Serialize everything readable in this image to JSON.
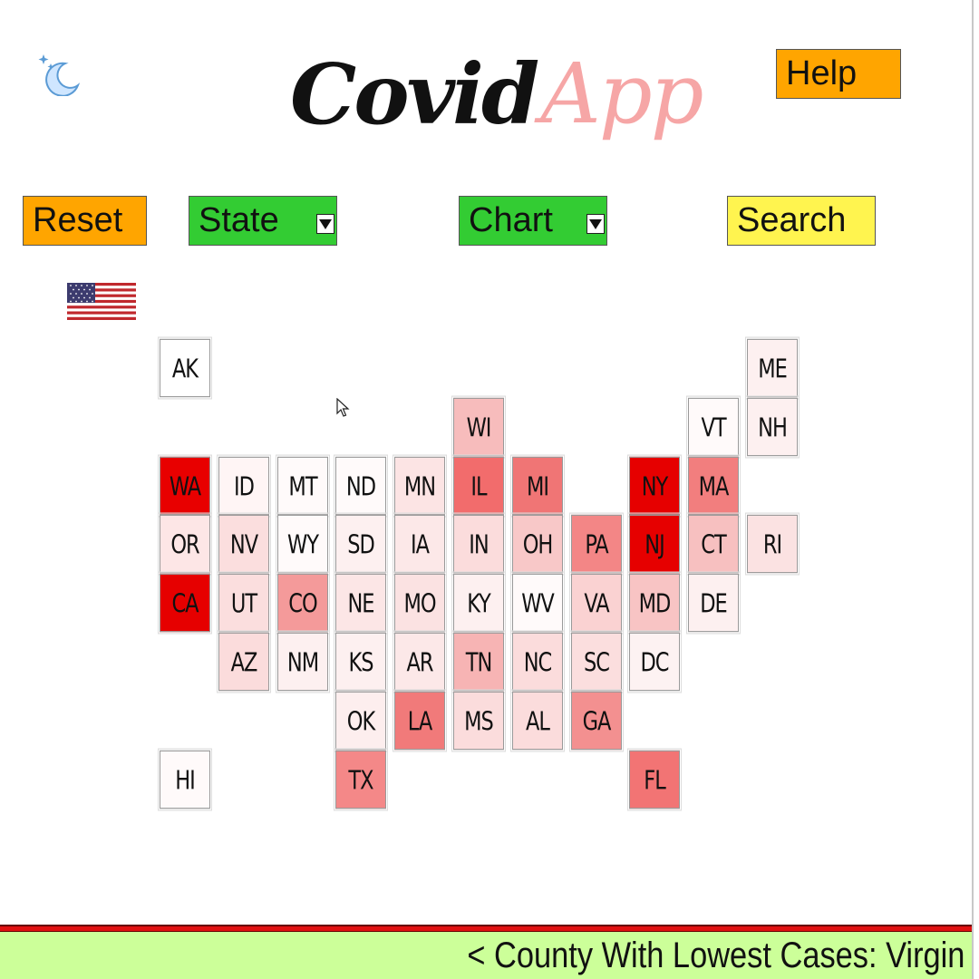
{
  "header": {
    "logo_word1": "Covid",
    "logo_word2": "App",
    "help_label": "Help",
    "theme_icon": "moon-stars-icon"
  },
  "toolbar": {
    "reset_label": "Reset",
    "state_label": "State",
    "chart_label": "Chart",
    "search_label": "Search"
  },
  "country_flag": "us-flag-icon",
  "colors": {
    "orange": "#ffa500",
    "green": "#33cc33",
    "yellow": "#fff44f",
    "footer_bg": "#ccff99",
    "footer_rule": "#e01010",
    "logo_pink": "#f6a6a6"
  },
  "map": {
    "layout": "tile-grid",
    "states": [
      {
        "code": "AK",
        "row": 0,
        "col": 0,
        "fill": "#ffffff"
      },
      {
        "code": "ME",
        "row": 0,
        "col": 10,
        "fill": "#fdf0f0"
      },
      {
        "code": "WI",
        "row": 1,
        "col": 5,
        "fill": "#f7bcbc"
      },
      {
        "code": "VT",
        "row": 1,
        "col": 9,
        "fill": "#fffafa"
      },
      {
        "code": "NH",
        "row": 1,
        "col": 10,
        "fill": "#fdf0f0"
      },
      {
        "code": "WA",
        "row": 2,
        "col": 0,
        "fill": "#e80000"
      },
      {
        "code": "ID",
        "row": 2,
        "col": 1,
        "fill": "#fff5f5"
      },
      {
        "code": "MT",
        "row": 2,
        "col": 2,
        "fill": "#fffafa"
      },
      {
        "code": "ND",
        "row": 2,
        "col": 3,
        "fill": "#fffafa"
      },
      {
        "code": "MN",
        "row": 2,
        "col": 4,
        "fill": "#fce4e4"
      },
      {
        "code": "IL",
        "row": 2,
        "col": 5,
        "fill": "#f26c6c"
      },
      {
        "code": "MI",
        "row": 2,
        "col": 6,
        "fill": "#f07575"
      },
      {
        "code": "NY",
        "row": 2,
        "col": 8,
        "fill": "#e60000"
      },
      {
        "code": "MA",
        "row": 2,
        "col": 9,
        "fill": "#f27e7e"
      },
      {
        "code": "OR",
        "row": 3,
        "col": 0,
        "fill": "#fde6e6"
      },
      {
        "code": "NV",
        "row": 3,
        "col": 1,
        "fill": "#fbdede"
      },
      {
        "code": "WY",
        "row": 3,
        "col": 2,
        "fill": "#fffafa"
      },
      {
        "code": "SD",
        "row": 3,
        "col": 3,
        "fill": "#fdf0f0"
      },
      {
        "code": "IA",
        "row": 3,
        "col": 4,
        "fill": "#fce8e8"
      },
      {
        "code": "IN",
        "row": 3,
        "col": 5,
        "fill": "#fbdcdc"
      },
      {
        "code": "OH",
        "row": 3,
        "col": 6,
        "fill": "#f8c8c8"
      },
      {
        "code": "PA",
        "row": 3,
        "col": 7,
        "fill": "#f38686"
      },
      {
        "code": "NJ",
        "row": 3,
        "col": 8,
        "fill": "#e60000"
      },
      {
        "code": "CT",
        "row": 3,
        "col": 9,
        "fill": "#f7c0c0"
      },
      {
        "code": "RI",
        "row": 3,
        "col": 10,
        "fill": "#fbe2e2"
      },
      {
        "code": "CA",
        "row": 4,
        "col": 0,
        "fill": "#e60000"
      },
      {
        "code": "UT",
        "row": 4,
        "col": 1,
        "fill": "#fbdede"
      },
      {
        "code": "CO",
        "row": 4,
        "col": 2,
        "fill": "#f49a9a"
      },
      {
        "code": "NE",
        "row": 4,
        "col": 3,
        "fill": "#fce6e6"
      },
      {
        "code": "MO",
        "row": 4,
        "col": 4,
        "fill": "#fbe2e2"
      },
      {
        "code": "KY",
        "row": 4,
        "col": 5,
        "fill": "#fdf0f0"
      },
      {
        "code": "WV",
        "row": 4,
        "col": 6,
        "fill": "#fffafa"
      },
      {
        "code": "VA",
        "row": 4,
        "col": 7,
        "fill": "#fad2d2"
      },
      {
        "code": "MD",
        "row": 4,
        "col": 8,
        "fill": "#f8c4c4"
      },
      {
        "code": "DE",
        "row": 4,
        "col": 9,
        "fill": "#fdf0f0"
      },
      {
        "code": "AZ",
        "row": 5,
        "col": 1,
        "fill": "#fbdcdc"
      },
      {
        "code": "NM",
        "row": 5,
        "col": 2,
        "fill": "#fdf0f0"
      },
      {
        "code": "KS",
        "row": 5,
        "col": 3,
        "fill": "#fdf0f0"
      },
      {
        "code": "AR",
        "row": 5,
        "col": 4,
        "fill": "#fce8e8"
      },
      {
        "code": "TN",
        "row": 5,
        "col": 5,
        "fill": "#f7b4b4"
      },
      {
        "code": "NC",
        "row": 5,
        "col": 6,
        "fill": "#fbdcdc"
      },
      {
        "code": "SC",
        "row": 5,
        "col": 7,
        "fill": "#fbdede"
      },
      {
        "code": "DC",
        "row": 5,
        "col": 8,
        "fill": "#fdf2f2"
      },
      {
        "code": "OK",
        "row": 6,
        "col": 3,
        "fill": "#fdeeee"
      },
      {
        "code": "LA",
        "row": 6,
        "col": 4,
        "fill": "#f17a7a"
      },
      {
        "code": "MS",
        "row": 6,
        "col": 5,
        "fill": "#fbdcdc"
      },
      {
        "code": "AL",
        "row": 6,
        "col": 6,
        "fill": "#fbdcdc"
      },
      {
        "code": "GA",
        "row": 6,
        "col": 7,
        "fill": "#f39090"
      },
      {
        "code": "HI",
        "row": 7,
        "col": 0,
        "fill": "#fffafa"
      },
      {
        "code": "TX",
        "row": 7,
        "col": 3,
        "fill": "#f48888"
      },
      {
        "code": "FL",
        "row": 7,
        "col": 8,
        "fill": "#f27474"
      }
    ]
  },
  "footer": {
    "ticker_text": "< County With Lowest Cases: Virgin"
  }
}
